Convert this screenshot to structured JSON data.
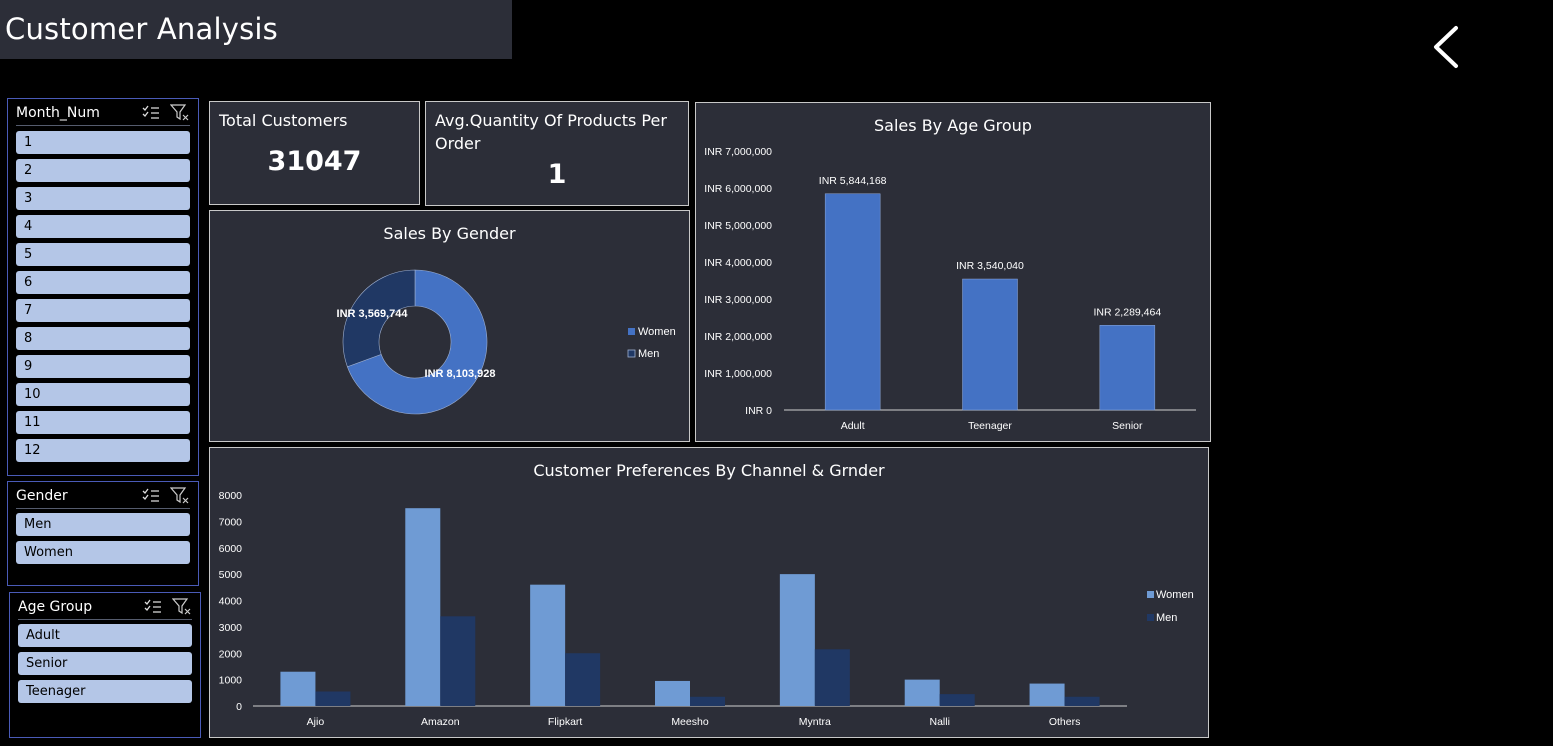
{
  "header": {
    "title": "Customer Analysis"
  },
  "back_button_icon": "chevron-left-icon",
  "slicers": {
    "month": {
      "label": "Month_Num",
      "items": [
        "1",
        "2",
        "3",
        "4",
        "5",
        "6",
        "7",
        "8",
        "9",
        "10",
        "11",
        "12"
      ]
    },
    "gender": {
      "label": "Gender",
      "items": [
        "Men",
        "Women"
      ]
    },
    "age_group": {
      "label": "Age Group",
      "items": [
        "Adult",
        "Senior",
        "Teenager"
      ]
    }
  },
  "kpis": {
    "total_customers": {
      "label": "Total Customers",
      "value": "31047"
    },
    "avg_quantity": {
      "label": "Avg.Quantity Of Products Per Order",
      "value": "1"
    }
  },
  "colors": {
    "women": "#4472c4",
    "men": "#203864",
    "women_light": "#6f9bd4",
    "bar_age": "#4472c4",
    "card_bg": "#2c2e38",
    "slicer_item": "#b4c6e7"
  },
  "chart_data": [
    {
      "id": "gender",
      "type": "pie",
      "title": "Sales By Gender",
      "slices": [
        {
          "name": "Women",
          "value": 8103928,
          "label": "INR 8,103,928"
        },
        {
          "name": "Men",
          "value": 3569744,
          "label": "INR 3,569,744"
        }
      ],
      "legend": [
        "Women",
        "Men"
      ],
      "legend_position": "right"
    },
    {
      "id": "age",
      "type": "bar",
      "title": "Sales By Age Group",
      "categories": [
        "Adult",
        "Teenager",
        "Senior"
      ],
      "values": [
        5844168,
        3540040,
        2289464
      ],
      "data_labels": [
        "INR 5,844,168",
        "INR 3,540,040",
        "INR 2,289,464"
      ],
      "y_ticks": [
        "INR 0",
        "INR 1,000,000",
        "INR 2,000,000",
        "INR 3,000,000",
        "INR 4,000,000",
        "INR 5,000,000",
        "INR 6,000,000",
        "INR 7,000,000"
      ],
      "ylim": [
        0,
        7000000
      ]
    },
    {
      "id": "channel",
      "type": "bar",
      "title": "Customer Preferences By Channel & Grnder",
      "categories": [
        "Ajio",
        "Amazon",
        "Flipkart",
        "Meesho",
        "Myntra",
        "Nalli",
        "Others"
      ],
      "series": [
        {
          "name": "Women",
          "values": [
            1300,
            7500,
            4600,
            950,
            5000,
            1000,
            850
          ]
        },
        {
          "name": "Men",
          "values": [
            550,
            3400,
            2000,
            350,
            2150,
            450,
            350
          ]
        }
      ],
      "y_ticks": [
        "0",
        "1000",
        "2000",
        "3000",
        "4000",
        "5000",
        "6000",
        "7000",
        "8000"
      ],
      "ylim": [
        0,
        8000
      ],
      "legend_position": "right"
    }
  ]
}
